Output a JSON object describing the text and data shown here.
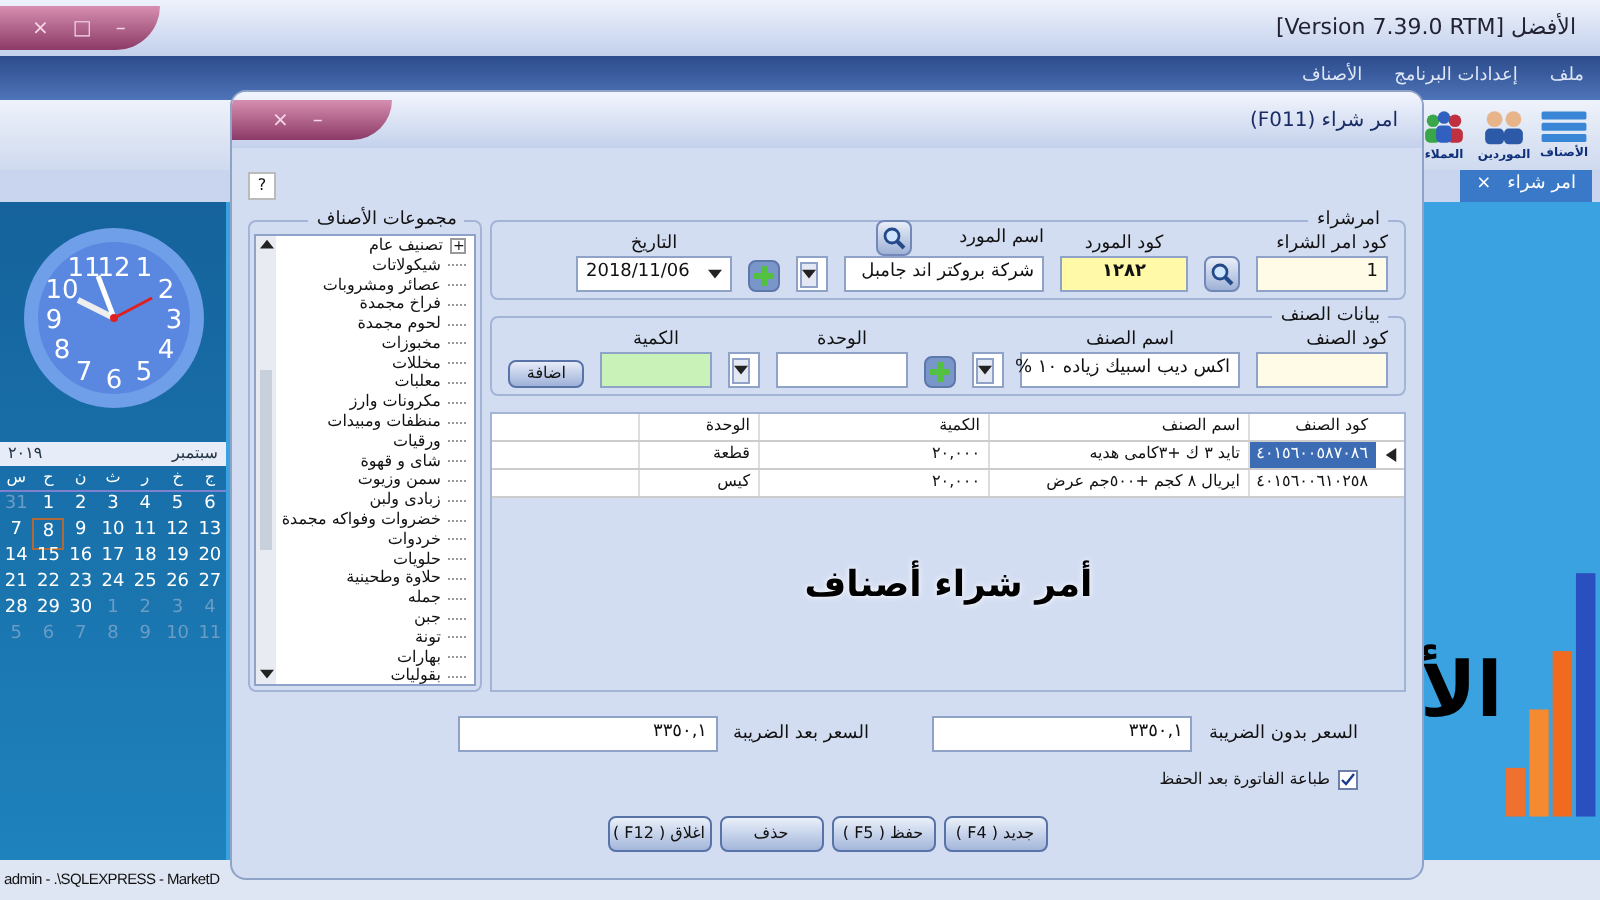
{
  "app": {
    "title": "الأفضل [Version 7.39.0 RTM]",
    "window_controls": [
      "–",
      "□",
      "×"
    ]
  },
  "menu": [
    "ملف",
    "إعدادات البرنامج",
    "الأصناف"
  ],
  "toolbar": [
    {
      "label": "الأصناف",
      "kind": "list"
    },
    {
      "label": "الموردين",
      "kind": "people"
    },
    {
      "label": "العملاء",
      "kind": "team"
    }
  ],
  "tabs": [
    {
      "label": "امر شراء",
      "selected": true,
      "close": "×"
    }
  ],
  "clock": {
    "numerals": [
      "1",
      "12",
      "11",
      "2",
      "10",
      "3",
      "9",
      "4",
      "8",
      "5",
      "6",
      "7"
    ]
  },
  "calendar": {
    "month": "سبتمبر",
    "year": "٢٠١٩",
    "weekdays": [
      "ج",
      "خ",
      "ر",
      "ث",
      "ن",
      "ح",
      "س"
    ],
    "weeks": [
      [
        {
          "d": "6",
          "outside": false,
          "selected": false
        },
        {
          "d": "5",
          "outside": false,
          "selected": false
        },
        {
          "d": "4",
          "outside": false,
          "selected": false
        },
        {
          "d": "3",
          "outside": false,
          "selected": false
        },
        {
          "d": "2",
          "outside": false,
          "selected": false
        },
        {
          "d": "1",
          "outside": false,
          "selected": false
        },
        {
          "d": "31",
          "outside": true,
          "selected": false
        }
      ],
      [
        {
          "d": "13",
          "outside": false,
          "selected": false
        },
        {
          "d": "12",
          "outside": false,
          "selected": false
        },
        {
          "d": "11",
          "outside": false,
          "selected": false
        },
        {
          "d": "10",
          "outside": false,
          "selected": false
        },
        {
          "d": "9",
          "outside": false,
          "selected": false
        },
        {
          "d": "8",
          "outside": false,
          "selected": true
        },
        {
          "d": "7",
          "outside": false,
          "selected": false
        }
      ],
      [
        {
          "d": "20",
          "outside": false,
          "selected": false
        },
        {
          "d": "19",
          "outside": false,
          "selected": false
        },
        {
          "d": "18",
          "outside": false,
          "selected": false
        },
        {
          "d": "17",
          "outside": false,
          "selected": false
        },
        {
          "d": "16",
          "outside": false,
          "selected": false
        },
        {
          "d": "15",
          "outside": false,
          "selected": false
        },
        {
          "d": "14",
          "outside": false,
          "selected": false
        }
      ],
      [
        {
          "d": "27",
          "outside": false,
          "selected": false
        },
        {
          "d": "26",
          "outside": false,
          "selected": false
        },
        {
          "d": "25",
          "outside": false,
          "selected": false
        },
        {
          "d": "24",
          "outside": false,
          "selected": false
        },
        {
          "d": "23",
          "outside": false,
          "selected": false
        },
        {
          "d": "22",
          "outside": false,
          "selected": false
        },
        {
          "d": "21",
          "outside": false,
          "selected": false
        }
      ],
      [
        {
          "d": "4",
          "outside": true,
          "selected": false
        },
        {
          "d": "3",
          "outside": true,
          "selected": false
        },
        {
          "d": "2",
          "outside": true,
          "selected": false
        },
        {
          "d": "1",
          "outside": true,
          "selected": false
        },
        {
          "d": "30",
          "outside": false,
          "selected": false
        },
        {
          "d": "29",
          "outside": false,
          "selected": false
        },
        {
          "d": "28",
          "outside": false,
          "selected": false
        }
      ],
      [
        {
          "d": "11",
          "outside": true,
          "selected": false
        },
        {
          "d": "10",
          "outside": true,
          "selected": false
        },
        {
          "d": "9",
          "outside": true,
          "selected": false
        },
        {
          "d": "8",
          "outside": true,
          "selected": false
        },
        {
          "d": "7",
          "outside": true,
          "selected": false
        },
        {
          "d": "6",
          "outside": true,
          "selected": false
        },
        {
          "d": "5",
          "outside": true,
          "selected": false
        }
      ]
    ]
  },
  "logo": {
    "text": "الأ"
  },
  "status_bar": "admin - .\\SQLEXPRESS - MarketD",
  "dialog": {
    "title": "امر شراء (F011)",
    "controls": [
      "–",
      "×"
    ],
    "help": "?",
    "groups_panel": {
      "title": "مجموعات الأصناف",
      "items": [
        {
          "label": "تصنيف عام",
          "kind": "group",
          "expand": "+"
        },
        {
          "label": "شيكولاتات",
          "kind": "leaf"
        },
        {
          "label": "عصائر ومشروبات",
          "kind": "leaf"
        },
        {
          "label": "فراخ مجمدة",
          "kind": "leaf"
        },
        {
          "label": "لحوم مجمدة",
          "kind": "leaf"
        },
        {
          "label": "مخبوزات",
          "kind": "leaf"
        },
        {
          "label": "مخللات",
          "kind": "leaf"
        },
        {
          "label": "معلبات",
          "kind": "leaf"
        },
        {
          "label": "مكرونات وارز",
          "kind": "leaf"
        },
        {
          "label": "منظفات ومبيدات",
          "kind": "leaf"
        },
        {
          "label": "ورقيات",
          "kind": "leaf"
        },
        {
          "label": "شاى و قهوة",
          "kind": "leaf"
        },
        {
          "label": "سمن وزيوت",
          "kind": "leaf"
        },
        {
          "label": "زبادى ولبن",
          "kind": "leaf"
        },
        {
          "label": "خضروات وفواكه مجمدة",
          "kind": "leaf"
        },
        {
          "label": "خردوات",
          "kind": "leaf"
        },
        {
          "label": "حلويات",
          "kind": "leaf"
        },
        {
          "label": "حلاوة وطحينية",
          "kind": "leaf"
        },
        {
          "label": "جمله",
          "kind": "leaf"
        },
        {
          "label": "جبن",
          "kind": "leaf"
        },
        {
          "label": "تونة",
          "kind": "leaf"
        },
        {
          "label": "بهارات",
          "kind": "leaf"
        },
        {
          "label": "بقوليات",
          "kind": "leaf"
        }
      ]
    },
    "order": {
      "title": "امرشراء",
      "order_code": {
        "label": "كود امر الشراء",
        "value": "1"
      },
      "supplier_code": {
        "label": "كود المورد",
        "value": "١٢٨٢"
      },
      "supplier_name": {
        "label": "اسم المورد",
        "value": "شركة بروكتر اند جامبل"
      },
      "date": {
        "label": "التاريخ",
        "value": "2018/11/06"
      }
    },
    "item": {
      "title": "بيانات الصنف",
      "item_code": {
        "label": "كود الصنف"
      },
      "item_name": {
        "label": "اسم الصنف",
        "value": "اكس ديب اسبيك زياده ١٠ %"
      },
      "unit": {
        "label": "الوحدة"
      },
      "quantity": {
        "label": "الكمية"
      },
      "add_button": "اضافة"
    },
    "table": {
      "columns": [
        "كود الصنف",
        "اسم الصنف",
        "الكمية",
        "الوحدة"
      ],
      "rows": [
        {
          "selected": true,
          "cells": [
            "٤٠١٥٦٠٠٥٨٧٠٨٦",
            "تايد ٣ ك +٣كامى هديه",
            "٢٠,٠٠٠",
            "قطعة"
          ]
        },
        {
          "selected": false,
          "cells": [
            "٤٠١٥٦٠٠٦١٠٢٥٨",
            "ايريال ٨ كجم +٥٠٠جم عرض",
            "٢٠,٠٠٠",
            "كيس"
          ]
        }
      ]
    },
    "watermark_title": "أمر شراء أصناف",
    "price_before_tax": {
      "label": "السعر بدون الضريبة",
      "value": "٣٣٥٠,١"
    },
    "price_after_tax": {
      "label": "السعر بعد الضريبة",
      "value": "٣٣٥٠,١"
    },
    "print_after_save": {
      "label": "طباعة الفاتورة بعد الحفظ",
      "checked": true
    },
    "buttons": [
      "جديد ( F4 )",
      "حفظ ( F5 )",
      "حذف",
      "اغلاق ( F12 )"
    ]
  }
}
